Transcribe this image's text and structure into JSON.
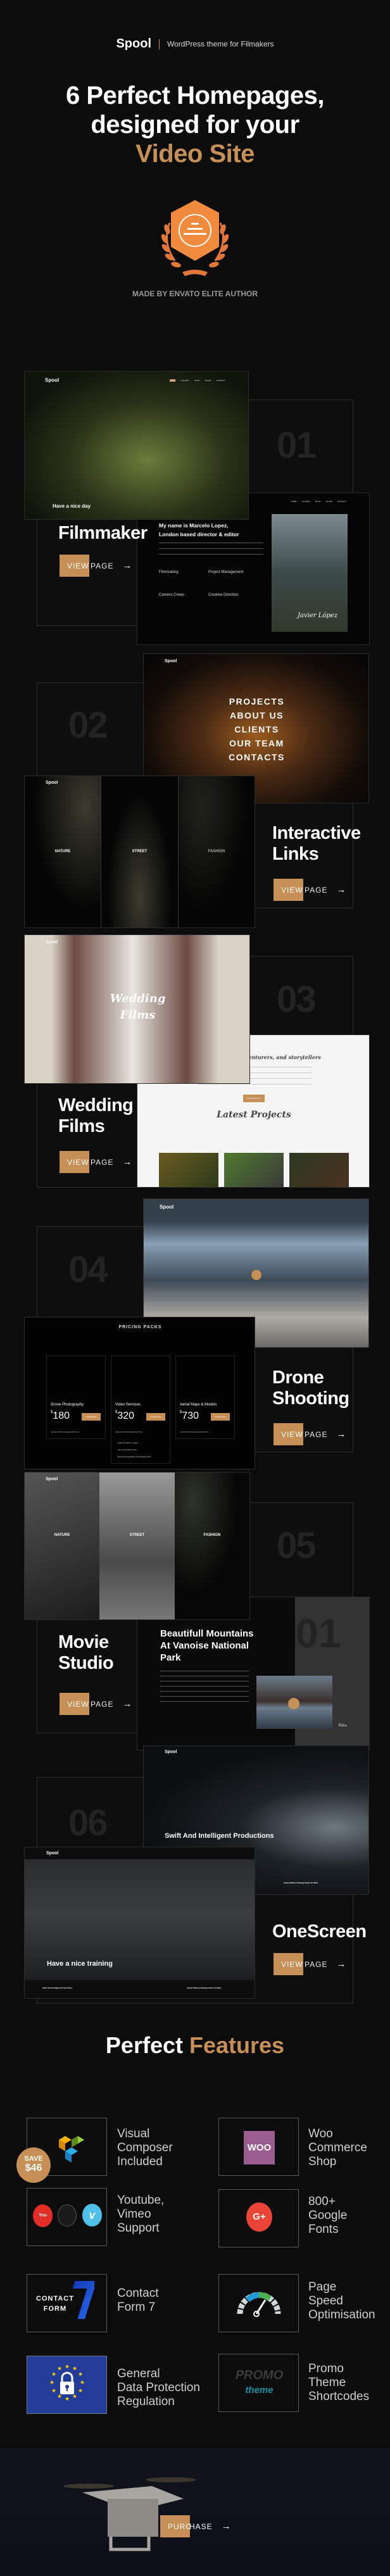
{
  "header": {
    "logo": "Spool",
    "tagline": "WordPress theme for Filmakers",
    "hero_line1": "6 Perfect Homepages,",
    "hero_line2": "designed for your",
    "hero_accent": "Video Site",
    "badge_caption": "MADE BY ENVATO ELITE AUTHOR"
  },
  "colors": {
    "accent": "#c58f55",
    "background": "#0c0c0c"
  },
  "demos": [
    {
      "number": "01",
      "title_lines": [
        "Filmmaker"
      ],
      "view_label": "VIEW",
      "page_label": "PAGE",
      "preview": {
        "logo": "Spool",
        "nav": [
          "HOME",
          "GALLERY",
          "BLOG",
          "PAGES",
          "CONTACT"
        ],
        "slide_caption": "Have a nice day",
        "about_heading_1": "My name is Marcelo Lopez,",
        "about_heading_2": "London based director & editor",
        "services": [
          "Filmmaking",
          "Project Management",
          "Camera Crews",
          "Creative Direction"
        ],
        "signature": "Javier López"
      }
    },
    {
      "number": "02",
      "title_lines": [
        "Interactive",
        "Links"
      ],
      "view_label": "VIEW",
      "page_label": "PAGE",
      "preview": {
        "logo": "Spool",
        "menu": [
          "PROJECTS",
          "ABOUT US",
          "CLIENTS",
          "OUR TEAM",
          "CONTACTS"
        ],
        "panels": [
          "NATURE",
          "STREET",
          "FASHION"
        ]
      }
    },
    {
      "number": "03",
      "title_lines": [
        "Wedding",
        "Films"
      ],
      "view_label": "VIEW",
      "page_label": "PAGE",
      "preview": {
        "logo": "Spool",
        "hero_script_1": "Wedding",
        "hero_script_2": "Films",
        "intro": "We are dreamers, adventurers, and storytellers",
        "cta": "WORK WITH US",
        "section": "Latest Projects"
      }
    },
    {
      "number": "04",
      "title_lines": [
        "Drone",
        "Shooting"
      ],
      "view_label": "VIEW",
      "page_label": "PAGE",
      "preview": {
        "logo": "Spool",
        "pricing_title": "PRICING PACKS",
        "packs": [
          {
            "name": "Drone Photography",
            "price": "180",
            "toggle": "SHOW OPTIONS DESCRIPTION"
          },
          {
            "name": "Video Services",
            "price": "320",
            "toggle": "HIDE OPTIONS DESCRIPTION"
          },
          {
            "name": "Aerial Maps & Models",
            "price": "730",
            "toggle": "SHOW OPTIONS DESCRIPTION"
          }
        ],
        "currency": "$",
        "purchase_label": "PURCHASE",
        "options": [
          "High Resolution Images",
          "4K & HD Quality Video",
          "Easily Downloadable & Shareable Files"
        ]
      }
    },
    {
      "number": "05",
      "title_lines": [
        "Movie",
        "Studio"
      ],
      "view_label": "VIEW",
      "page_label": "PAGE",
      "preview": {
        "logo": "Spool",
        "panels": [
          "NATURE",
          "STREET",
          "FASHION"
        ],
        "post_title_1": "Beautifull Mountains",
        "post_title_2": "At Vanoise National",
        "post_title_3": "Park",
        "slide_counter": "01",
        "slide_total": "05",
        "big_number": "01"
      }
    },
    {
      "number": "06",
      "title_lines": [
        "OneScreen"
      ],
      "view_label": "VIEW",
      "page_label": "PAGE",
      "preview": {
        "logo": "Spool",
        "caption_back": "Swift And Intelligent Productions",
        "caption_front": "Have a nice training",
        "prev_item": "Swift And Intelligent Productions",
        "next_item": "Vastly Different Backgrounds On Wall"
      }
    }
  ],
  "features": {
    "title": "Perfect",
    "title_accent": "Features",
    "save_label": "SAVE",
    "save_amount": "$46",
    "items": [
      {
        "icon": "visual-composer-icon",
        "lines": [
          "Visual",
          "Composer",
          "Included"
        ]
      },
      {
        "icon": "woocommerce-icon",
        "lines": [
          "Woo",
          "Commerce",
          "Shop"
        ],
        "logo_text": "WOO"
      },
      {
        "icon": "video-platforms-icon",
        "lines": [
          "Youtube,",
          "Vimeo",
          "Support"
        ]
      },
      {
        "icon": "google-plus-icon",
        "lines": [
          "800+",
          "Google",
          "Fonts"
        ],
        "logo_text": "G+"
      },
      {
        "icon": "contact-form-7-icon",
        "lines": [
          "Contact",
          "Form 7"
        ],
        "logo_text_1": "CONTACT",
        "logo_text_2": "FORM"
      },
      {
        "icon": "speedometer-icon",
        "lines": [
          "Page",
          "Speed",
          "Optimisation"
        ]
      },
      {
        "icon": "gdpr-lock-icon",
        "lines": [
          "General",
          "Data Protection",
          "Regulation"
        ]
      },
      {
        "icon": "promo-theme-icon",
        "lines": [
          "Promo",
          "Theme",
          "Shortcodes"
        ],
        "logo_text_1": "PROMO",
        "logo_text_2": "theme"
      }
    ]
  },
  "footer": {
    "purchase_a": "PURC",
    "purchase_b": "HASE"
  }
}
